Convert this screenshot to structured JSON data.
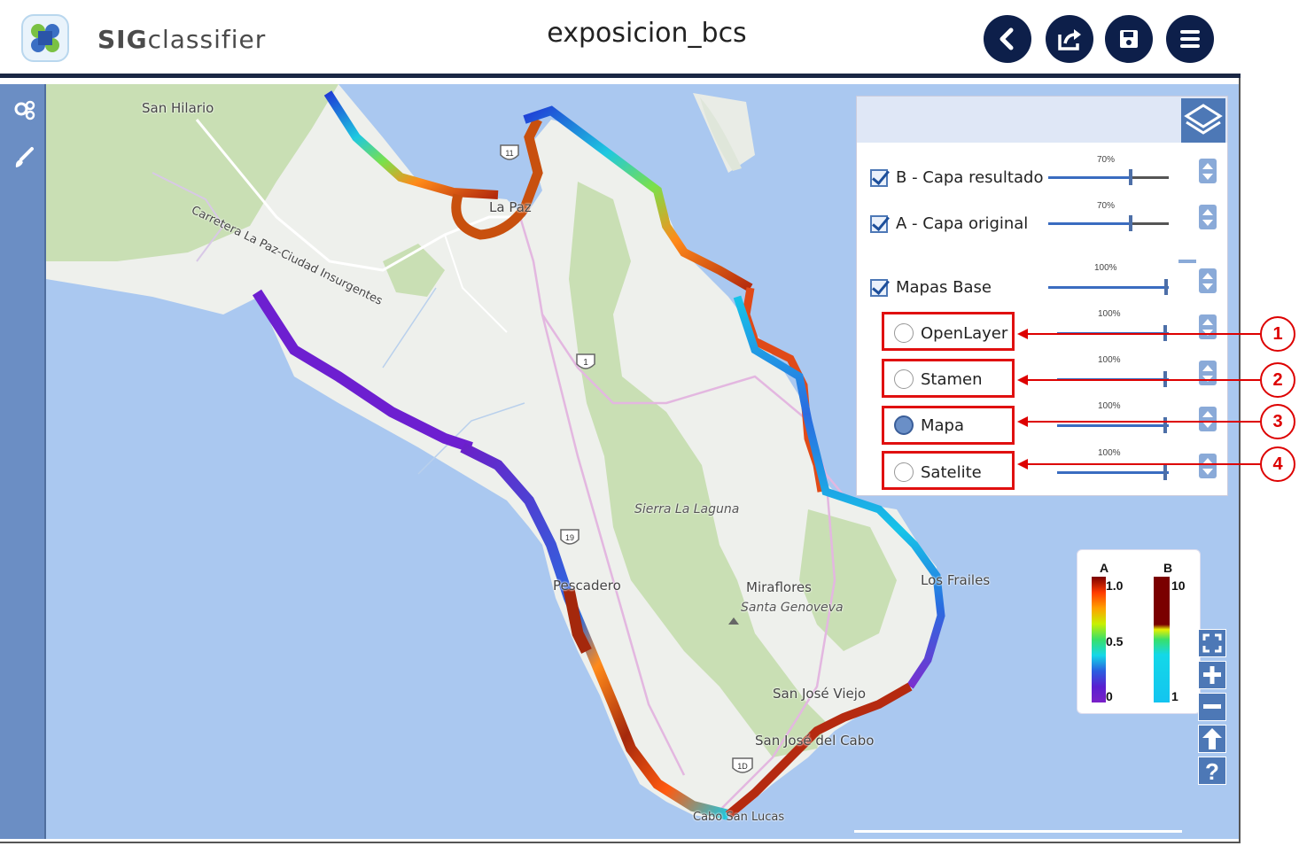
{
  "header": {
    "brand_bold": "SIG",
    "brand_light": "classifier",
    "title": "exposicion_bcs",
    "buttons": [
      "back-icon",
      "export-icon",
      "save-icon",
      "menu-icon"
    ]
  },
  "sidebar": {
    "icons": [
      "gears-icon",
      "brush-icon"
    ]
  },
  "map": {
    "labels": {
      "san_hilario": "San Hilario",
      "road": "Carretera La Paz-Ciudad Insurgentes",
      "la_paz": "La Paz",
      "sierra": "Sierra La Laguna",
      "pescadero": "Pescadero",
      "miraflores": "Miraflores",
      "santa_genoveva": "Santa Genoveva",
      "los_frailes": "Los Frailes",
      "sjv": "San José Viejo",
      "sjc": "San José del Cabo",
      "cabo": "Cabo San Lucas",
      "hwy1": "1",
      "hwy19": "19",
      "hwy1d": "1D",
      "hwy11": "11"
    }
  },
  "layers": {
    "rows": [
      {
        "label": "B - Capa resultado",
        "pct": "70%",
        "value": 0.7,
        "checked": true
      },
      {
        "label": "A - Capa original",
        "pct": "70%",
        "value": 0.7,
        "checked": true
      },
      {
        "label": "Mapas Base",
        "pct": "100%",
        "value": 1.0,
        "checked": true
      }
    ],
    "base_maps": [
      {
        "label": "OpenLayer",
        "pct": "100%",
        "selected": false
      },
      {
        "label": "Stamen",
        "pct": "100%",
        "selected": false
      },
      {
        "label": "Mapa",
        "pct": "100%",
        "selected": true
      },
      {
        "label": "Satelite",
        "pct": "100%",
        "selected": false
      }
    ]
  },
  "legend": {
    "a_title": "A",
    "a_max": "1.0",
    "a_mid": "0.5",
    "a_min": "0",
    "b_title": "B",
    "b_max": "10",
    "b_min": "1"
  },
  "zoom_controls": [
    "fullscreen-icon",
    "zoom-in-icon",
    "zoom-out-icon",
    "north-arrow-icon",
    "help-icon"
  ],
  "callouts": [
    "1",
    "2",
    "3",
    "4"
  ],
  "colors": {
    "accent": "#0d1f4a",
    "panel": "#4d78b6",
    "callout": "#e01010"
  }
}
